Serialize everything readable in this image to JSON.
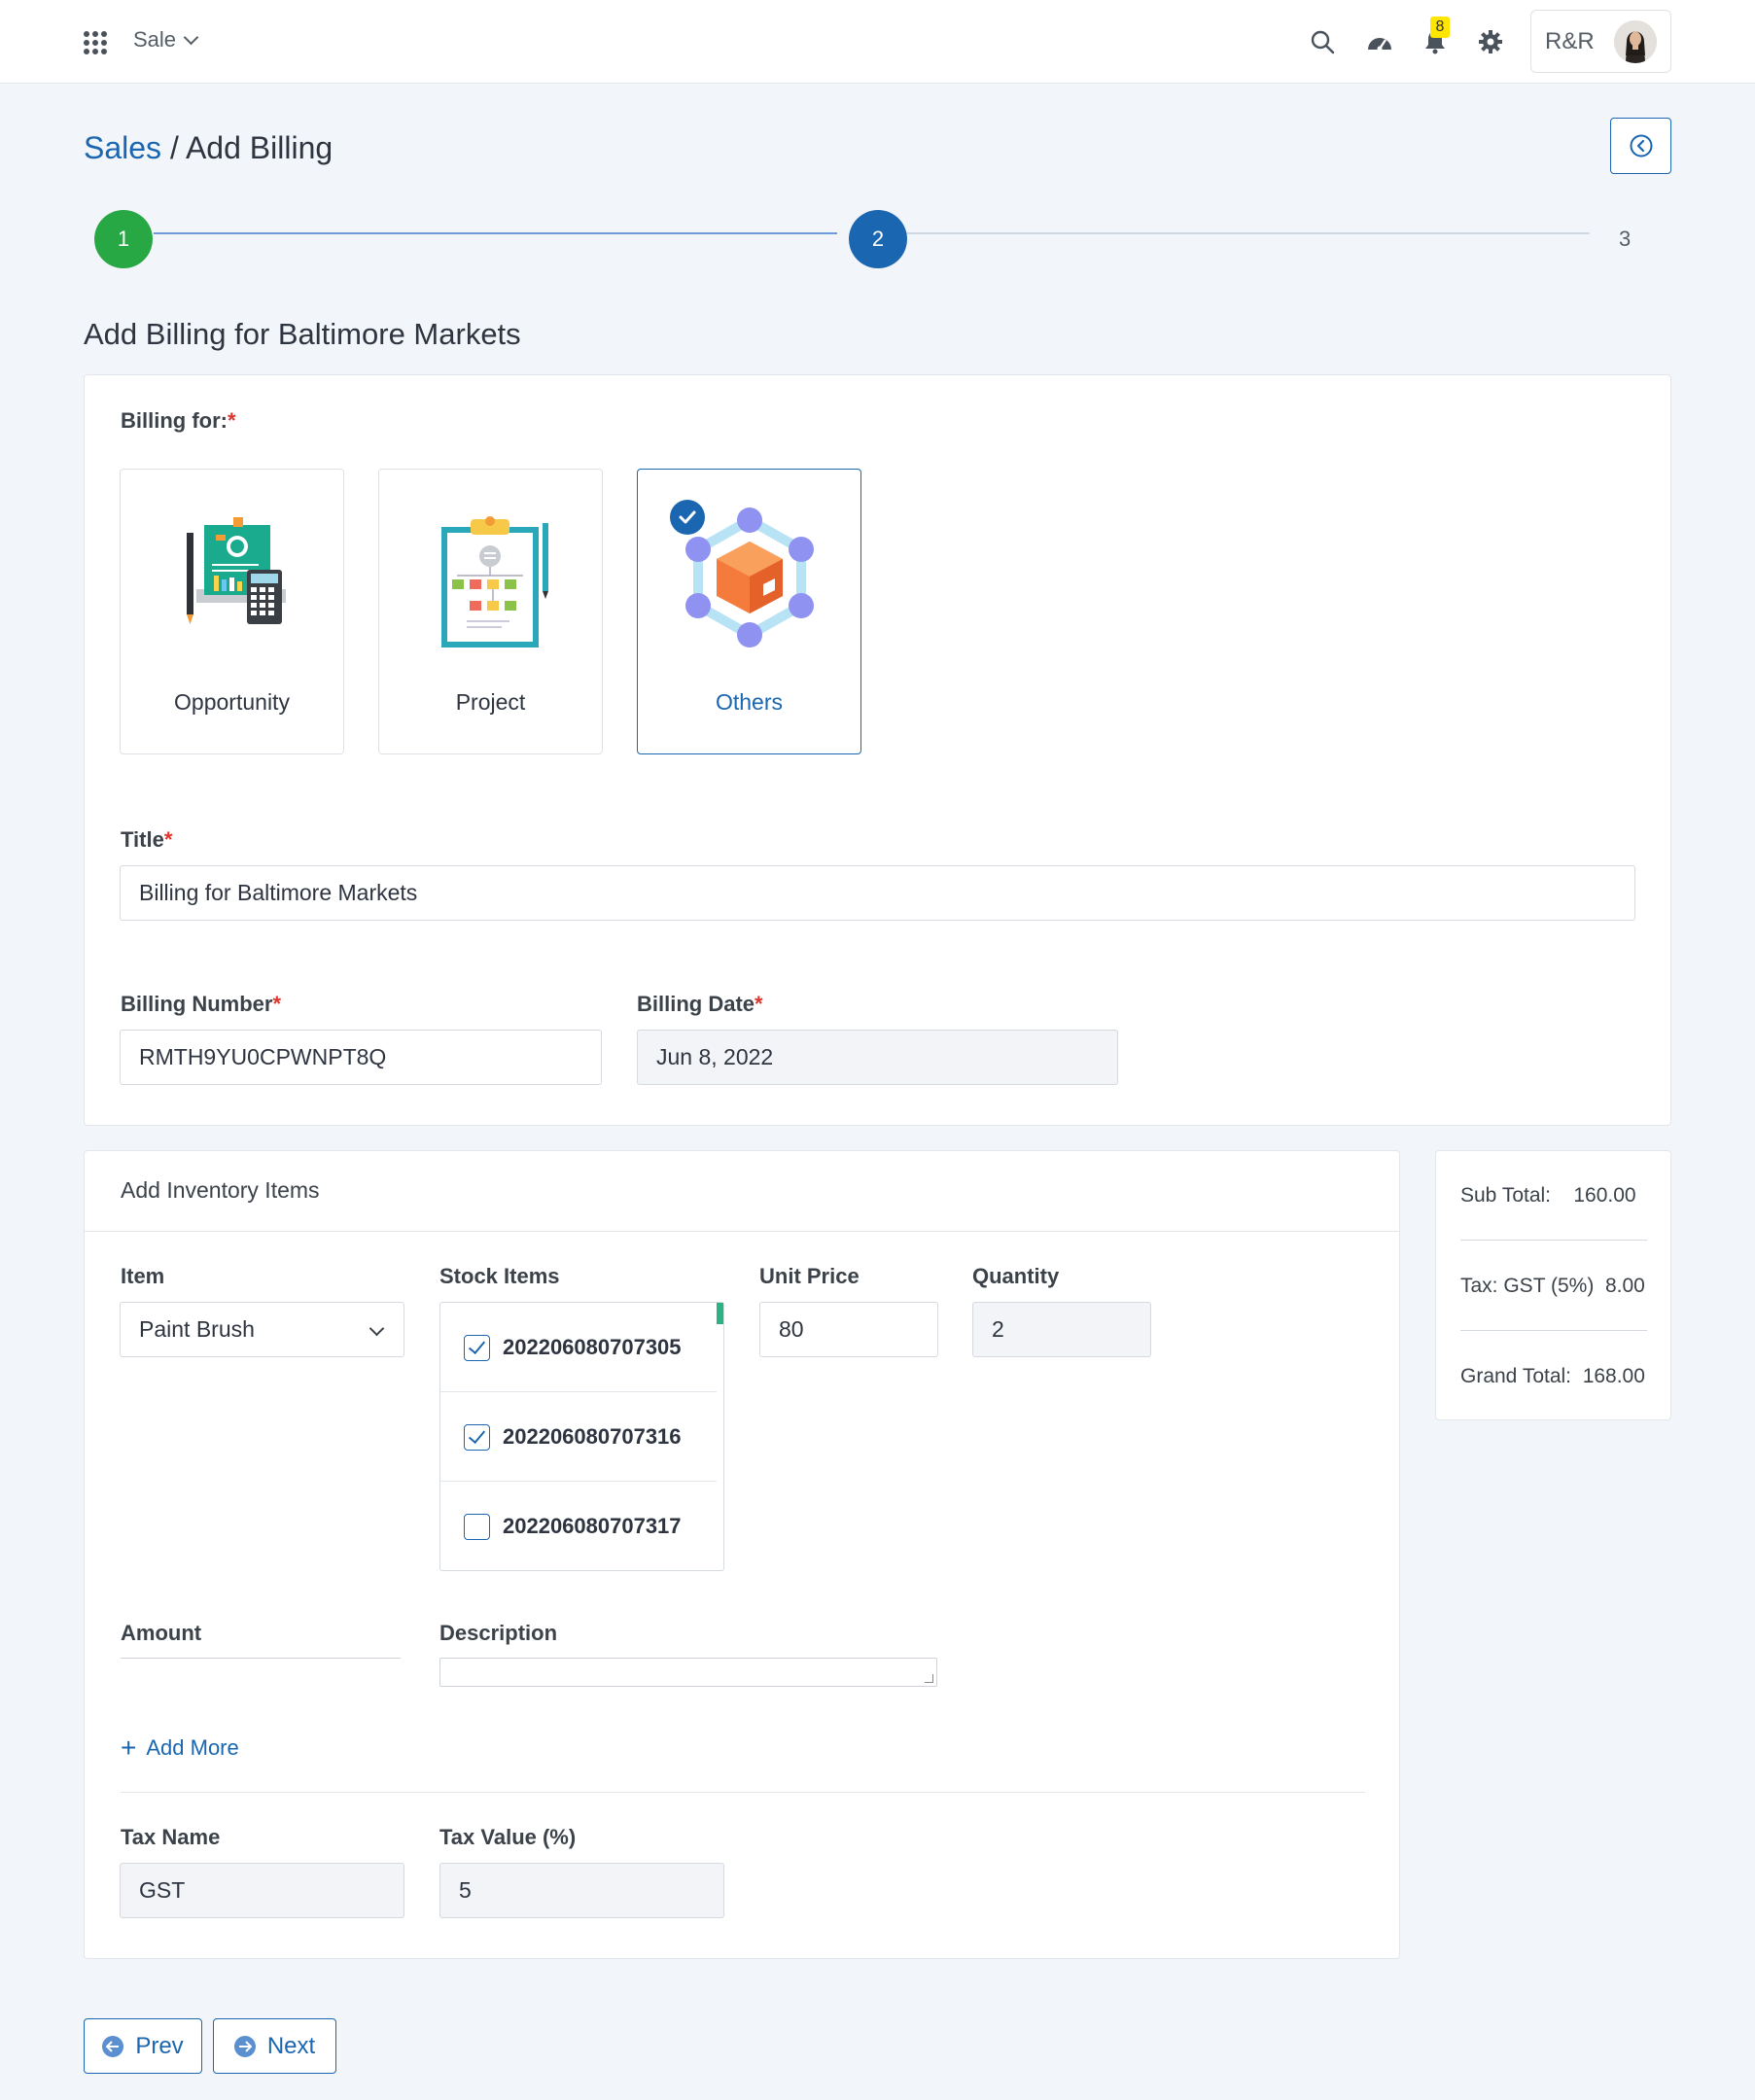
{
  "header": {
    "module": "Sale",
    "notification_count": "8",
    "user_initials": "R&R"
  },
  "breadcrumb": {
    "parent": "Sales",
    "separator": " / ",
    "current": "Add Billing"
  },
  "stepper": {
    "steps": [
      "1",
      "2",
      "3"
    ],
    "colors": {
      "done": "#27a844",
      "active": "#1a66b0"
    }
  },
  "page": {
    "section_title": "Add Billing for Baltimore Markets"
  },
  "billing_form": {
    "billing_for_label": "Billing for:",
    "required_mark": "*",
    "options": [
      {
        "label": "Opportunity",
        "icon": "opportunity-illustration-icon"
      },
      {
        "label": "Project",
        "icon": "project-clipboard-icon"
      },
      {
        "label": "Others",
        "icon": "others-box-network-icon",
        "selected": true
      }
    ],
    "title_label": "Title",
    "title_value": "Billing for Baltimore Markets",
    "billing_number_label": "Billing Number",
    "billing_number_value": "RMTH9YU0CPWNPT8Q",
    "billing_date_label": "Billing Date",
    "billing_date_value": "Jun 8, 2022"
  },
  "inventory": {
    "header": "Add Inventory Items",
    "item_label": "Item",
    "item_value": "Paint Brush",
    "stock_label": "Stock Items",
    "stock_items": [
      {
        "number": "202206080707305",
        "checked": true
      },
      {
        "number": "202206080707316",
        "checked": true
      },
      {
        "number": "202206080707317",
        "checked": false
      }
    ],
    "unit_price_label": "Unit Price",
    "unit_price_value": "80",
    "quantity_label": "Quantity",
    "quantity_value": "2",
    "amount_label": "Amount",
    "description_label": "Description",
    "add_more_label": "Add More",
    "tax_name_label": "Tax Name",
    "tax_name_value": "GST",
    "tax_value_label": "Tax Value (%)",
    "tax_value_value": "5"
  },
  "summary": {
    "sub_total_label": "Sub Total:",
    "sub_total_value": "160.00",
    "tax_label": "Tax: GST (5%)",
    "tax_value": "8.00",
    "grand_total_label": "Grand Total:",
    "grand_total_value": "168.00"
  },
  "nav": {
    "prev_label": "Prev",
    "next_label": "Next"
  }
}
